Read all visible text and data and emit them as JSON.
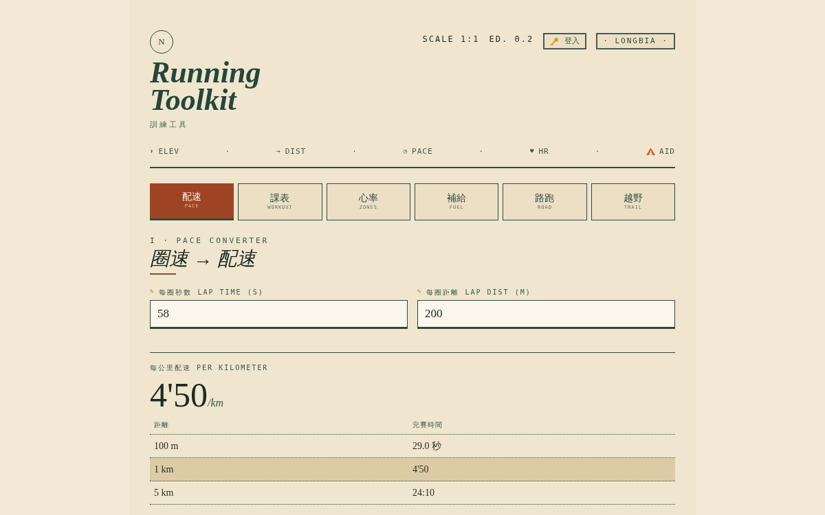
{
  "brand": {
    "mark": "N",
    "title_line1": "Running",
    "title_line2": "Toolkit",
    "subtitle": "訓練工具"
  },
  "meta": {
    "scale": "SCALE 1:1",
    "edition": "ED. 0.2"
  },
  "login_button": "登入",
  "user_button": "· LONGBIA ·",
  "nav": {
    "separator": "·",
    "items": [
      {
        "kind": "glyph",
        "glyph": "↟",
        "label": "ELEV"
      },
      {
        "kind": "glyph",
        "glyph": "→",
        "label": "DIST"
      },
      {
        "kind": "glyph",
        "glyph": "◷",
        "label": "PACE"
      },
      {
        "kind": "glyph",
        "glyph": "♥",
        "label": "HR"
      },
      {
        "kind": "tent",
        "label": "AID"
      }
    ]
  },
  "tabs": [
    {
      "label": "配速",
      "sub": "PACE",
      "selected": true
    },
    {
      "label": "課表",
      "sub": "WORKOUT",
      "selected": false
    },
    {
      "label": "心率",
      "sub": "ZONES",
      "selected": false
    },
    {
      "label": "補給",
      "sub": "FUEL",
      "selected": false
    },
    {
      "label": "路跑",
      "sub": "ROAD",
      "selected": false
    },
    {
      "label": "越野",
      "sub": "TRAIL",
      "selected": false
    }
  ],
  "section": {
    "eyebrow": "I · PACE CONVERTER",
    "title": "圈速 → 配速"
  },
  "fields": [
    {
      "glyph": "✎",
      "label_zh": "每圈秒數",
      "label": "LAP TIME (S)",
      "value": "58"
    },
    {
      "glyph": "✎",
      "label_zh": "每圈距離",
      "label": "LAP DIST (M)",
      "value": "200"
    }
  ],
  "result": {
    "label_zh": "每公里配速",
    "label": "PER KILOMETER",
    "value": "4'50",
    "unit": "/km"
  },
  "table": {
    "columns": [
      "距離",
      "完賽時間"
    ],
    "rows": [
      {
        "cells": [
          "100 m",
          "29.0 秒"
        ],
        "selected": false
      },
      {
        "cells": [
          "1 km",
          "4'50"
        ],
        "selected": true
      },
      {
        "cells": [
          "5 km",
          "24:10"
        ],
        "selected": false
      }
    ]
  }
}
